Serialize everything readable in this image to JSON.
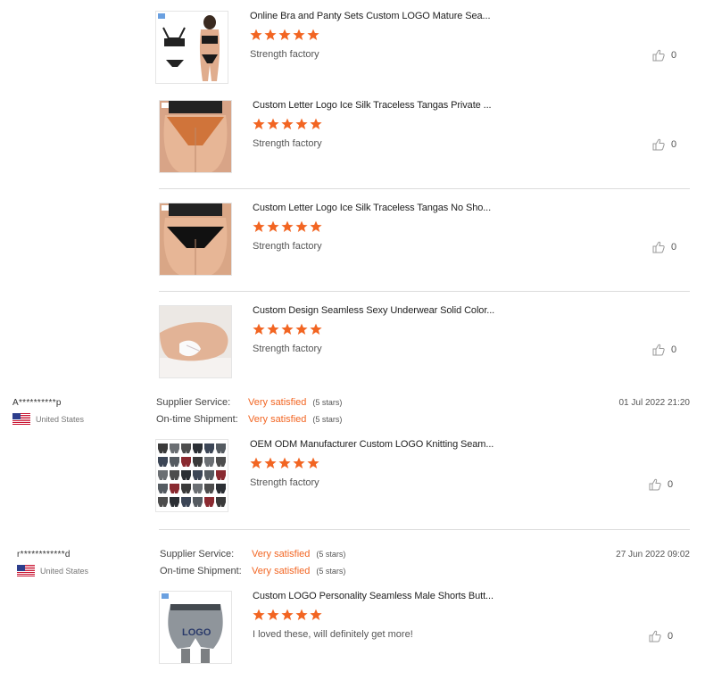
{
  "common": {
    "product_rating": 5,
    "star_color": "#f26522",
    "like_icon": "thumbs-up-icon",
    "flag_icon": "us-flag-icon"
  },
  "products": [
    {
      "title": "Online Bra and Panty Sets Custom LOGO Mature Sea...",
      "review_text": "Strength factory",
      "likes": "0",
      "image": "bra-panty-set"
    },
    {
      "title": "Custom Letter Logo Ice Silk Traceless Tangas Private ...",
      "review_text": "Strength factory",
      "likes": "0",
      "image": "orange-thong"
    },
    {
      "title": "Custom Letter Logo Ice Silk Traceless Tangas No Sho...",
      "review_text": "Strength factory",
      "likes": "0",
      "image": "black-thong"
    },
    {
      "title": "Custom Design Seamless Sexy Underwear Solid Color...",
      "review_text": "Strength factory",
      "likes": "0",
      "image": "white-underwear"
    },
    {
      "title": "OEM ODM Manufacturer Custom LOGO Knitting Seam...",
      "review_text": "Strength factory",
      "likes": "0",
      "image": "boxer-grid"
    },
    {
      "title": "Custom LOGO Personality Seamless Male Shorts Butt...",
      "review_text": "I loved these, will definitely get more!",
      "likes": "0",
      "image": "grey-boxer",
      "image_logo_text": "LOGO"
    }
  ],
  "reviews": [
    {
      "user": "A**********p",
      "country": "United States",
      "date": "01 Jul 2022 21:20",
      "supplier_service": {
        "label": "Supplier Service:",
        "value": "Very satisfied",
        "stars": "(5 stars)"
      },
      "on_time_shipment": {
        "label": "On-time Shipment:",
        "value": "Very satisfied",
        "stars": "(5 stars)"
      }
    },
    {
      "user": "r************d",
      "country": "United States",
      "date": "27 Jun 2022 09:02",
      "supplier_service": {
        "label": "Supplier Service:",
        "value": "Very satisfied",
        "stars": "(5 stars)"
      },
      "on_time_shipment": {
        "label": "On-time Shipment:",
        "value": "Very satisfied",
        "stars": "(5 stars)"
      }
    }
  ]
}
